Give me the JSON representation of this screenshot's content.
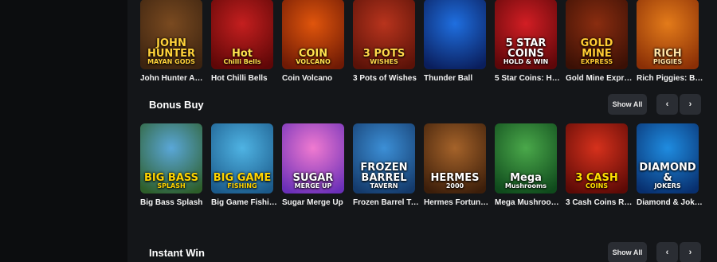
{
  "top_row": {
    "games": [
      {
        "name": "John Hunter And...",
        "logo1": "JOHN HUNTER",
        "logo2": "MAYAN GODS",
        "bg1": "#7a4a20",
        "bg2": "#3b2310",
        "logo_color": "#ffd23a"
      },
      {
        "name": "Hot Chilli Bells",
        "logo1": "Hot",
        "logo2": "Chilli Bells",
        "bg1": "#c41f1f",
        "bg2": "#5e0707",
        "logo_color": "#ffe14d"
      },
      {
        "name": "Coin Volcano",
        "logo1": "COIN",
        "logo2": "VOLCANO",
        "bg1": "#e0550c",
        "bg2": "#6e1a05",
        "logo_color": "#ffe14d"
      },
      {
        "name": "3 Pots of Wishes",
        "logo1": "3 POTS",
        "logo2": "WISHES",
        "bg1": "#b8341d",
        "bg2": "#5a1208",
        "logo_color": "#ffd84a"
      },
      {
        "name": "Thunder Ball",
        "logo1": "",
        "logo2": "",
        "bg1": "#1f6fe0",
        "bg2": "#0a1e5c",
        "logo_color": "#ffffff"
      },
      {
        "name": "5 Star Coins: Hol...",
        "logo1": "5 STAR COINS",
        "logo2": "HOLD & WIN",
        "bg1": "#d21e24",
        "bg2": "#5d0709",
        "logo_color": "#ffffff"
      },
      {
        "name": "Gold Mine Expre...",
        "logo1": "GOLD MINE",
        "logo2": "EXPRESS",
        "bg1": "#8a2d10",
        "bg2": "#3a1005",
        "logo_color": "#ffcc33"
      },
      {
        "name": "Rich Piggies: Bo...",
        "logo1": "RICH",
        "logo2": "PIGGIES",
        "bg1": "#e37b1a",
        "bg2": "#8a2f06",
        "logo_color": "#ffe3a6"
      }
    ]
  },
  "bonus_buy": {
    "title": "Bonus Buy",
    "show_all": "Show All",
    "prev_icon": "‹",
    "next_icon": "›",
    "games": [
      {
        "name": "Big Bass Splash",
        "logo1": "BIG BASS",
        "logo2": "SPLASH",
        "bg1": "#5aa7d8",
        "bg2": "#2d5e2a",
        "logo_color": "#ffd400"
      },
      {
        "name": "Big Game Fishin...",
        "logo1": "BIG GAME",
        "logo2": "FISHING",
        "bg1": "#4fb3e3",
        "bg2": "#1b5a8a",
        "logo_color": "#ffd400"
      },
      {
        "name": "Sugar Merge Up",
        "logo1": "SUGAR",
        "logo2": "MERGE UP",
        "bg1": "#f07ad0",
        "bg2": "#6a2fb8",
        "logo_color": "#ffffff"
      },
      {
        "name": "Frozen Barrel Ta...",
        "logo1": "FROZEN BARREL",
        "logo2": "TAVERN",
        "bg1": "#3c8fd6",
        "bg2": "#143a6b",
        "logo_color": "#ffffff"
      },
      {
        "name": "Hermes Fortune...",
        "logo1": "HERMES",
        "logo2": "2000",
        "bg1": "#a5632a",
        "bg2": "#3c1e0a",
        "logo_color": "#ffffff"
      },
      {
        "name": "Mega Mushrooms",
        "logo1": "Mega",
        "logo2": "Mushrooms",
        "bg1": "#4aa84a",
        "bg2": "#0f4a1c",
        "logo_color": "#ffffff"
      },
      {
        "name": "3 Cash Coins RU...",
        "logo1": "3 CASH",
        "logo2": "COINS",
        "bg1": "#d6311c",
        "bg2": "#5c0a06",
        "logo_color": "#ffe000"
      },
      {
        "name": "Diamond & Joke...",
        "logo1": "DIAMOND &",
        "logo2": "JOKERS",
        "bg1": "#1f8ce0",
        "bg2": "#082f6e",
        "logo_color": "#ffffff"
      }
    ]
  },
  "instant_win": {
    "title": "Instant Win",
    "show_all": "Show All",
    "prev_icon": "‹",
    "next_icon": "›"
  },
  "colors": {
    "background": "#141619",
    "sidebar": "#0c0d0f",
    "button_bg": "#2a2d33"
  }
}
